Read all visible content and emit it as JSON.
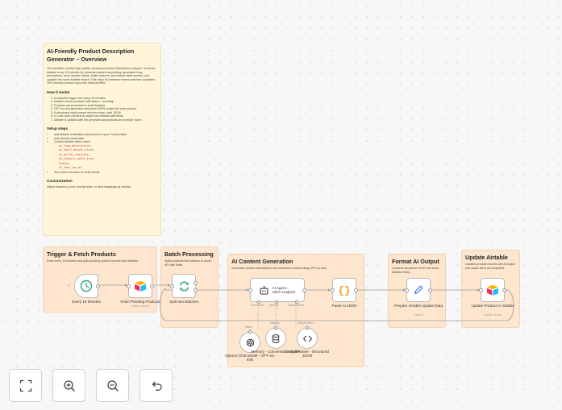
{
  "overview": {
    "title": "AI-Friendly Product Description Generator – Overview",
    "intro": "This workflow creates high-quality, structured product descriptions using AI. It checks Airtable every 15 minutes for products marked as pending, generates long descriptions, short answer blocks, bullet features, and feature table content, and updates the same Airtable record. This helps eCommerce teams maintain consistent, GEO-friendly product copy with minimal effort.",
    "how_title": "How it works",
    "how_steps": [
      "A schedule trigger runs every 15 minutes.",
      "Airtable returns products with status = “pending”.",
      "Products are processed in small batches.",
      "GPT-4o-mini generates structured JSON content for each product.",
      "A structured output parser ensures clean, valid JSON.",
      "A Code node converts AI output into Airtable-safe fields.",
      "Airtable is updated with the generated descriptions and marked “done”."
    ],
    "setup_title": "Setup steps",
    "setup_steps": [
      "Add Airtable credentials and connect to your Product table.",
      "Add OpenAI credentials.",
      "Confirm Airtable fields match:"
    ],
    "fields": [
      "ai_long_description,",
      "ai_short_answer_block,",
      "ai_bullet_features,",
      "ai_feature_table_json,",
      "status,",
      "ai_last_run_at."
    ],
    "setup_last": "Run a test execution to verify results.",
    "custom_title": "Customization",
    "custom_text": "Adjust frequency, tone, prompt style, or field mappings as needed."
  },
  "groups": {
    "trigger": {
      "title": "Trigger & Fetch Products",
      "desc": "Runs every 15 minutes and pulls pending product records from Airtable."
    },
    "batch": {
      "title": "Batch Processing",
      "desc": "Splits products into batches to avoid API rate limits."
    },
    "ai": {
      "title": "AI Content Generation",
      "desc": "Generates product descriptions and structured content using GPT-4o-mini."
    },
    "format": {
      "title": "Format AI Output",
      "desc": "Converts structured JSON into clean Airtable fields."
    },
    "update": {
      "title": "Update Airtable",
      "desc": "Updates product records with AI output and marks them as completed."
    }
  },
  "nodes": {
    "schedule": {
      "label": "Every 15 Minutes",
      "icon": "clock-icon"
    },
    "fetch": {
      "label": "Fetch Pending Products",
      "sub": "search: record",
      "icon": "airtable-icon"
    },
    "split": {
      "label": "Split Into Batches",
      "icon": "loop-icon"
    },
    "agent": {
      "label": "AI Agent - GEO Analyzer",
      "icon": "robot-icon"
    },
    "parse": {
      "label": "Parse AI JSON",
      "icon": "braces-icon"
    },
    "prepare": {
      "label": "Prepare Airtable Update Data",
      "sub": "manual",
      "icon": "pen-icon"
    },
    "update": {
      "label": "Update Product in Airtable",
      "sub": "update: record",
      "icon": "airtable-icon"
    },
    "model": {
      "label": "OpenAI Chat Model - GPT-4o-mini",
      "icon": "openai-icon"
    },
    "memory": {
      "label": "Memory - Conversation Buffer",
      "icon": "database-icon"
    },
    "parser": {
      "label": "Output Parser - Structured JSON",
      "icon": "code-icon"
    }
  },
  "ports": {
    "chat_model": "Chat Model",
    "memory": "Memory",
    "output_parser": "Output Parser",
    "model": "Model",
    "memory2": "Memory",
    "output_parser2": "Output Parser"
  },
  "colors": {
    "sticky": "#fde6cd",
    "note": "#fff6d9",
    "schedule": "#2fa67a",
    "airtable": "#18bfff",
    "code": "#f59d22",
    "pen": "#3d6ff2"
  },
  "controls": [
    "fit-view-button",
    "zoom-in-button",
    "zoom-out-button",
    "undo-button"
  ]
}
